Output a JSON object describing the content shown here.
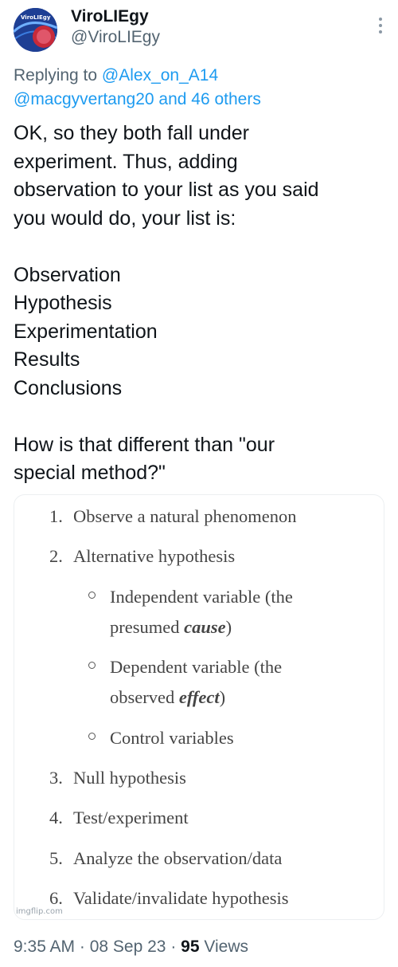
{
  "author": {
    "display_name": "ViroLIEgy",
    "handle": "@ViroLIEgy",
    "avatar_text": "ViroLIEgy"
  },
  "reply": {
    "prefix": "Replying to",
    "mention1": "@Alex_on_A14",
    "mention2": "@macgyvertang20 and 46 others"
  },
  "tweet": {
    "p1": [
      "OK, so they both fall under",
      "experiment. Thus, adding",
      "observation to your list as you said",
      "you would do, your list is:"
    ],
    "list": [
      "Observation",
      "Hypothesis",
      "Experimentation",
      "Results",
      "Conclusions"
    ],
    "p3": [
      "How is that different than \"our",
      "special method?\""
    ]
  },
  "media": {
    "items": [
      {
        "num": "1.",
        "text": "Observe a natural phenomenon"
      },
      {
        "num": "2.",
        "text": "Alternative hypothesis"
      },
      {
        "num": "3.",
        "text": "Null hypothesis"
      },
      {
        "num": "4.",
        "text": "Test/experiment"
      },
      {
        "num": "5.",
        "text": "Analyze the observation/data"
      },
      {
        "num": "6.",
        "text": "Validate/invalidate hypothesis"
      }
    ],
    "subitems": [
      {
        "line1": "Independent variable (the",
        "line2_pre": "presumed ",
        "line2_em": "cause",
        "line2_post": ")"
      },
      {
        "line1": "Dependent variable (the",
        "line2_pre": "observed ",
        "line2_em": "effect",
        "line2_post": ")"
      },
      {
        "line1": "Control variables"
      }
    ],
    "watermark": "imgflip.com"
  },
  "footer": {
    "time": "9:35 AM",
    "sep1": " · ",
    "date": "08 Sep 23",
    "sep2": " · ",
    "views_count": "95",
    "views_label": " Views"
  },
  "colors": {
    "link": "#1d9bf0",
    "muted": "#536471",
    "text": "#0f1419"
  }
}
